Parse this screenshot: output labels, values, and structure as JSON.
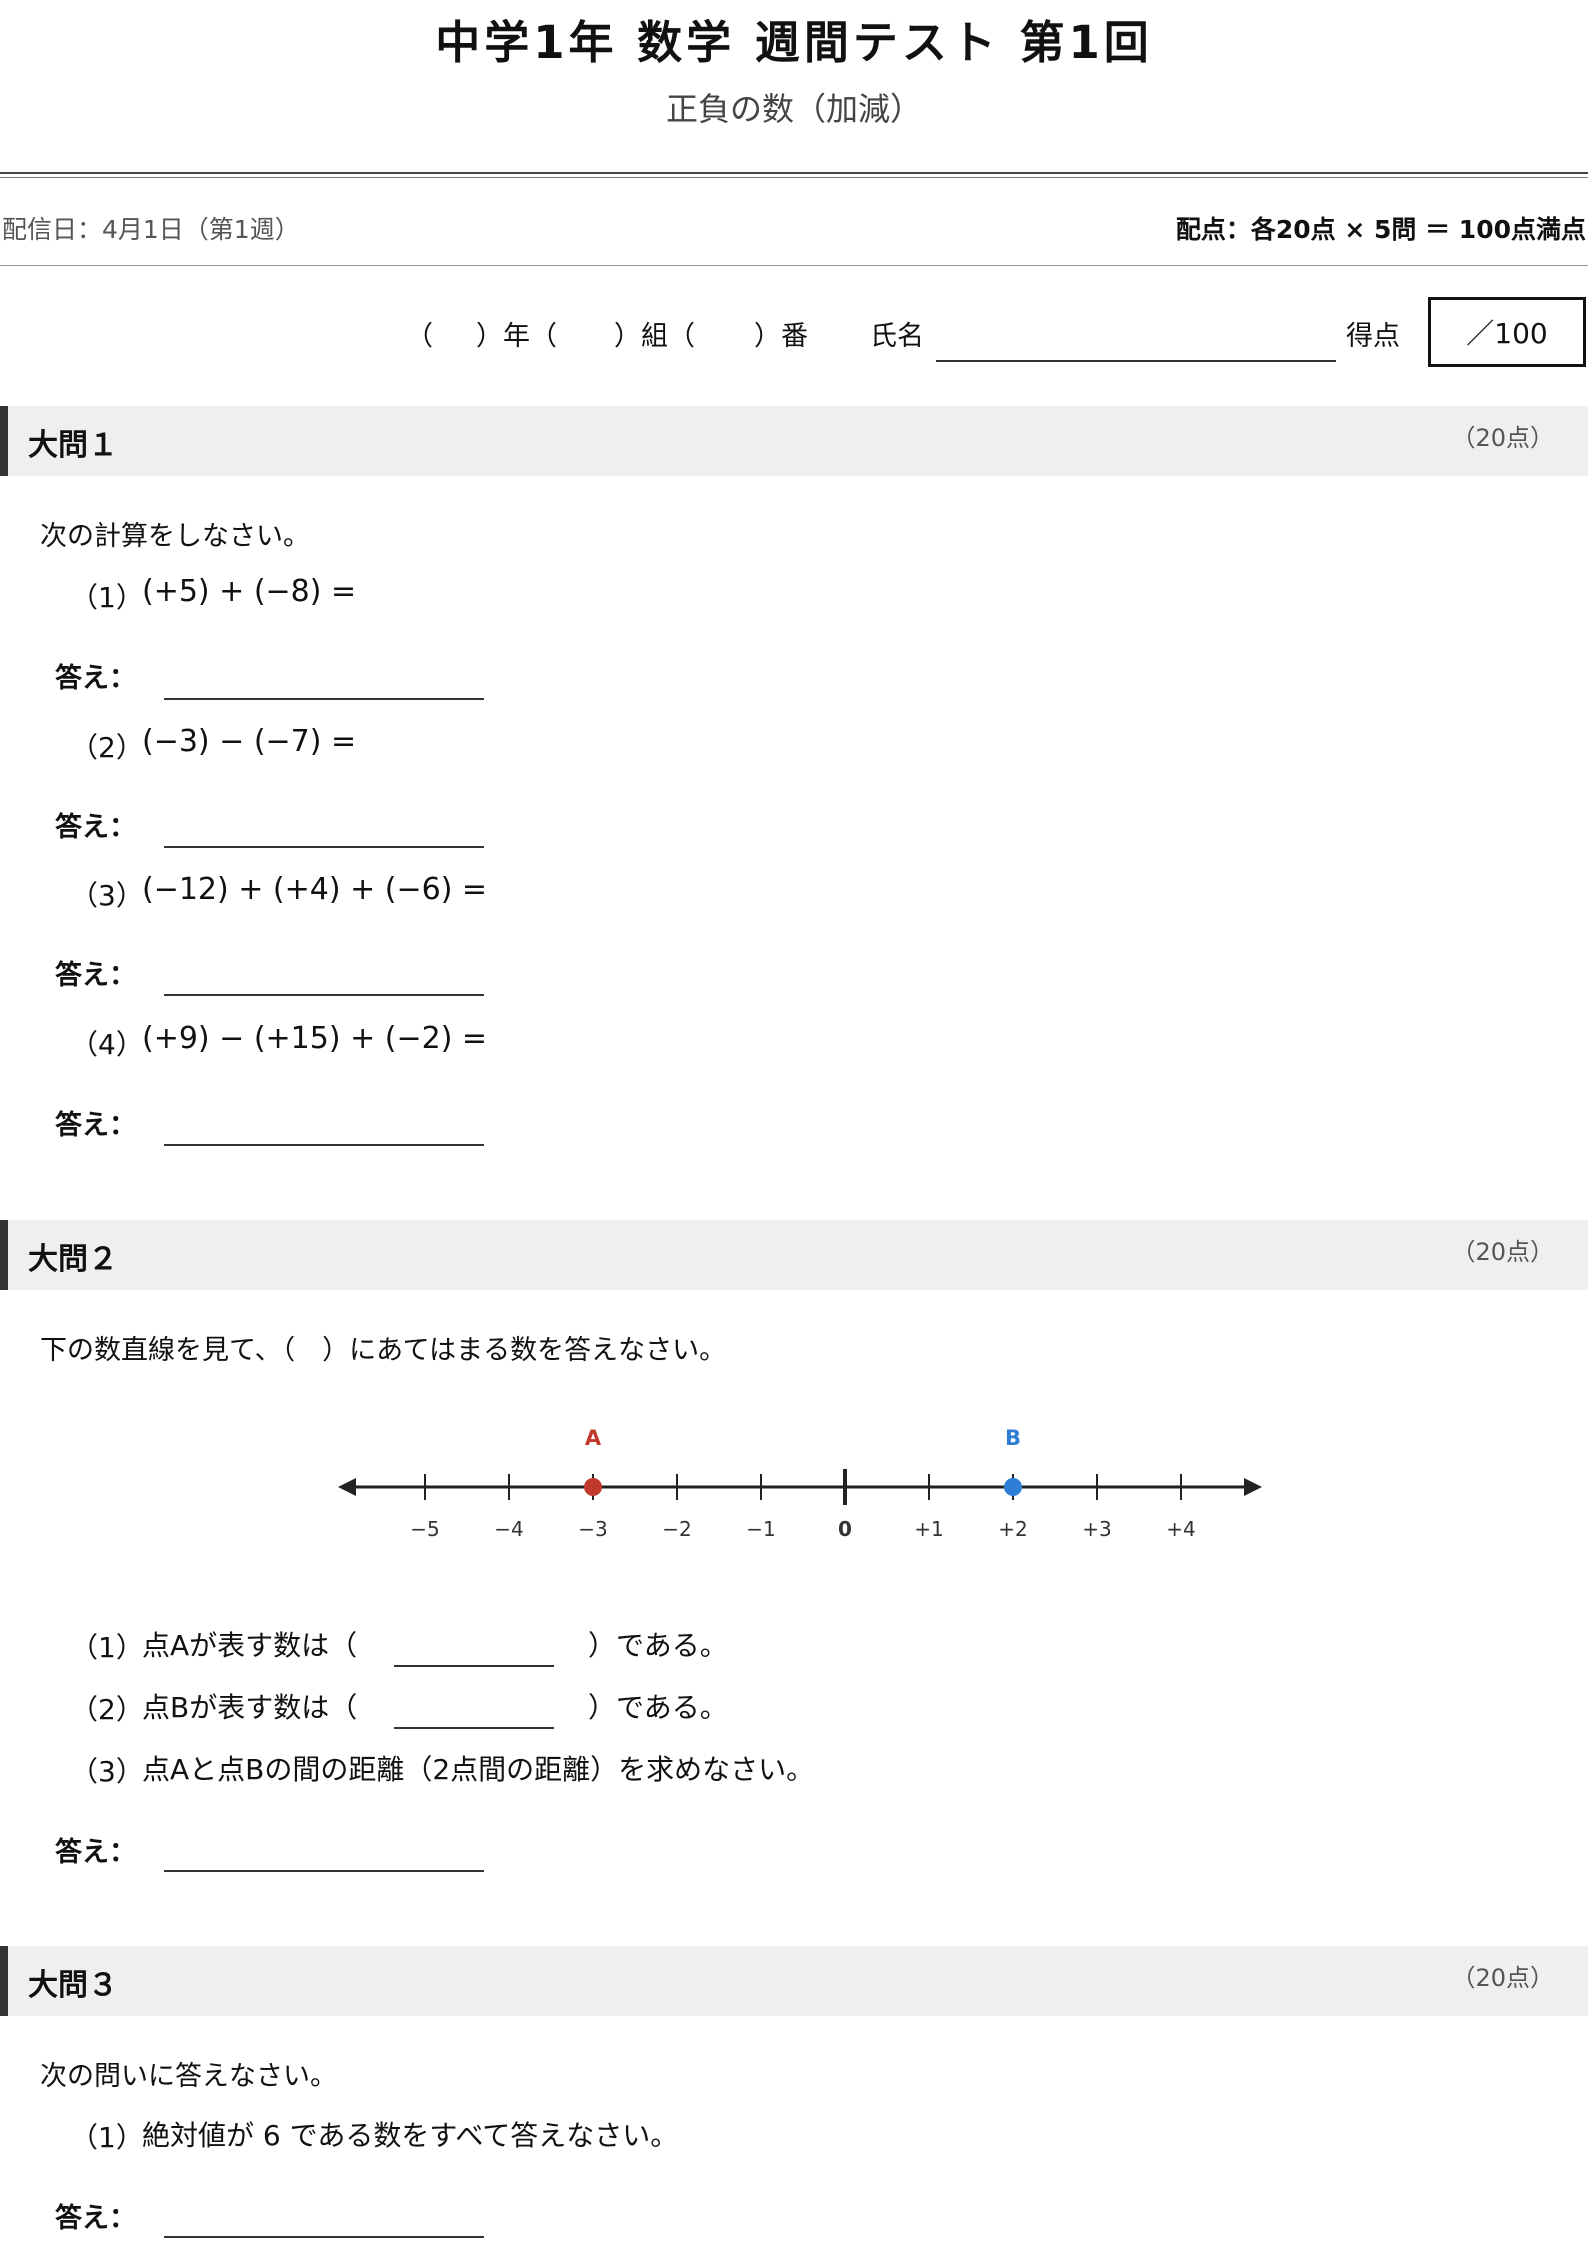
{
  "header": {
    "title": "中学1年 数学 週間テスト 第1回",
    "subtitle": "正負の数（加減）",
    "date": "配信日：4月1日（第1週）",
    "scoring": "配点：各20点 × 5問 ＝ 100点満点"
  },
  "student": {
    "year_open": "（",
    "year_label": "）年（",
    "class_label": "）組（",
    "number_label": "）番",
    "name_label": "氏名",
    "score_label": "得点",
    "score_box": "／100"
  },
  "sections": [
    {
      "title": "大問１",
      "points": "（20点）",
      "instruction": "次の計算をしなさい。",
      "questions": [
        {
          "num": "（1）",
          "text": "(+5) + (−8) ="
        },
        {
          "num": "（2）",
          "text": "(−3) − (−7) ="
        },
        {
          "num": "（3）",
          "text": "(−12) + (+4) + (−6) ="
        },
        {
          "num": "（4）",
          "text": "(+9) − (+15) + (−2) ="
        }
      ],
      "answer_label": "答え："
    },
    {
      "title": "大問２",
      "points": "（20点）",
      "instruction": "下の数直線を見て、（　）にあてはまる数を答えなさい。",
      "questions": [
        {
          "num": "（1）",
          "text_before": "点Aが表す数は（",
          "text_after": "）である。"
        },
        {
          "num": "（2）",
          "text_before": "点Bが表す数は（",
          "text_after": "）である。"
        },
        {
          "num": "（3）",
          "text": "点Aと点Bの間の距離（2点間の距離）を求めなさい。"
        }
      ],
      "answer_label": "答え："
    },
    {
      "title": "大問３",
      "points": "（20点）",
      "instruction": "次の問いに答えなさい。",
      "questions": [
        {
          "num": "（1）",
          "text": "絶対値が 6 である数をすべて答えなさい。"
        }
      ],
      "answer_label": "答え："
    }
  ],
  "number_line": {
    "ticks": [
      {
        "value": -5,
        "label": "−5"
      },
      {
        "value": -4,
        "label": "−4"
      },
      {
        "value": -3,
        "label": "−3"
      },
      {
        "value": -2,
        "label": "−2"
      },
      {
        "value": -1,
        "label": "−1"
      },
      {
        "value": 0,
        "label": "0"
      },
      {
        "value": 1,
        "label": "+1"
      },
      {
        "value": 2,
        "label": "+2"
      },
      {
        "value": 3,
        "label": "+3"
      },
      {
        "value": 4,
        "label": "+4"
      }
    ],
    "points": [
      {
        "label": "A",
        "value": -3,
        "color": "#c0392b"
      },
      {
        "label": "B",
        "value": 2,
        "color": "#2e7ed6"
      }
    ]
  }
}
